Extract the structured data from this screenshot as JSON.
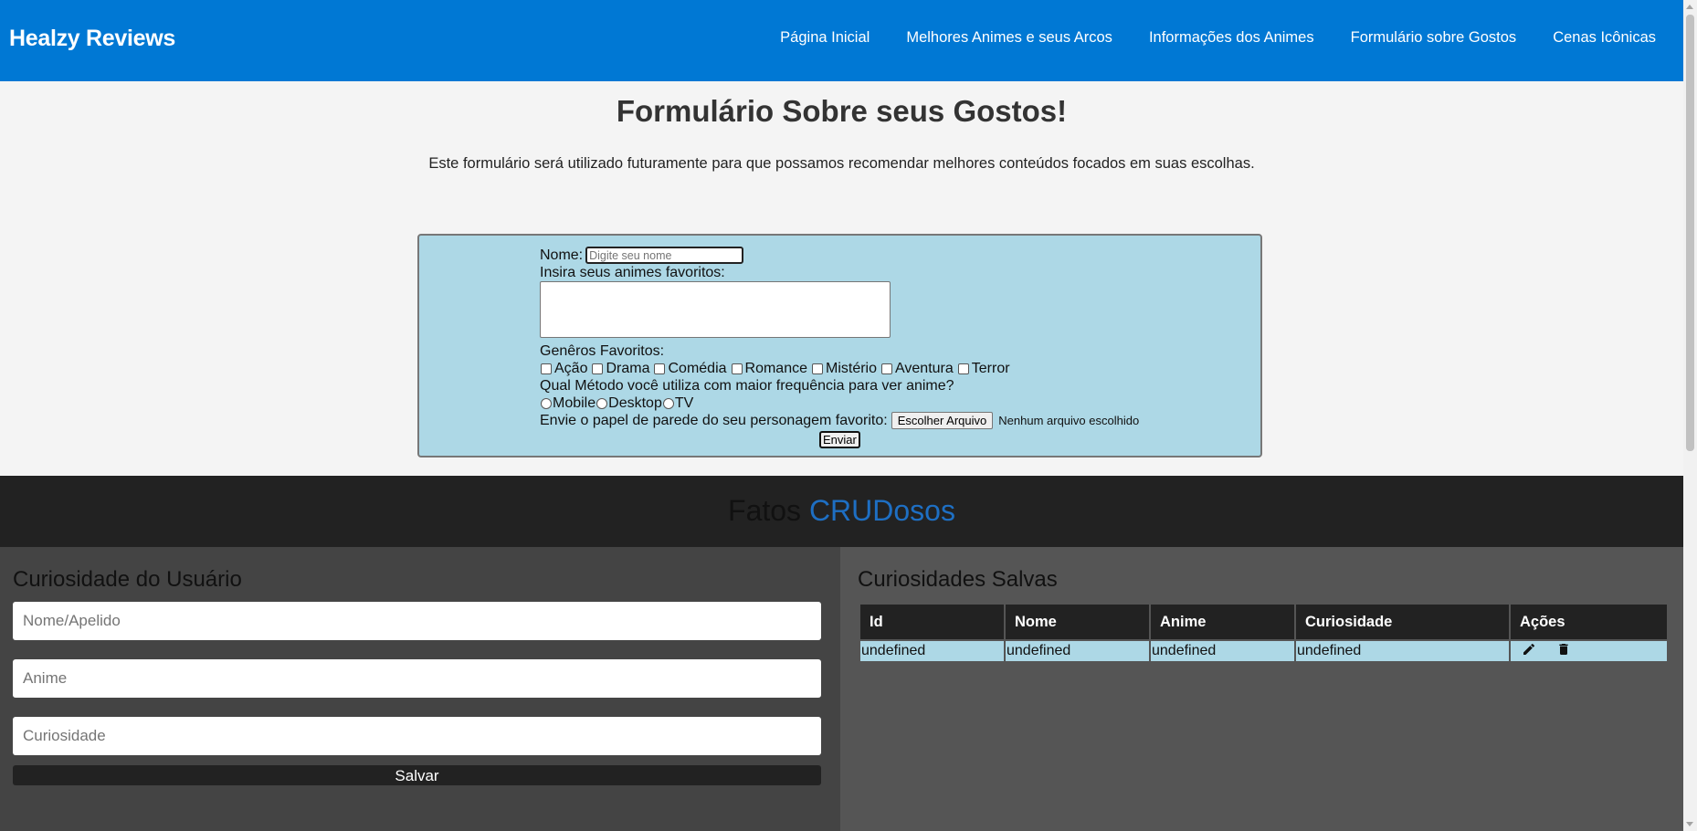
{
  "header": {
    "brand": "Healzy Reviews",
    "nav": [
      "Página Inicial",
      "Melhores Animes e seus Arcos",
      "Informações dos Animes",
      "Formulário sobre Gostos",
      "Cenas Icônicas"
    ]
  },
  "hero": {
    "title": "Formulário Sobre seus Gostos!",
    "subtitle": "Este formulário será utilizado futuramente para que possamos recomendar melhores conteúdos focados em suas escolhas."
  },
  "form": {
    "name_label": "Nome:",
    "name_placeholder": "Digite seu nome",
    "animes_label": "Insira seus animes favoritos:",
    "genres_label": "Genêros Favoritos:",
    "genres": [
      "Ação",
      "Drama",
      "Comédia",
      "Romance",
      "Mistério",
      "Aventura",
      "Terror"
    ],
    "method_label": "Qual Método você utiliza com maior frequência para ver anime?",
    "methods": [
      "Mobile",
      "Desktop",
      "TV"
    ],
    "upload_label": "Envie o papel de parede do seu personagem favorito:",
    "file_button": "Escolher Arquivo",
    "file_status": "Nenhum arquivo escolhido",
    "submit": "Enviar"
  },
  "fatos": {
    "title_plain": "Fatos ",
    "title_highlight": "CRUDosos"
  },
  "user_curiosity": {
    "title": "Curiosidade do Usuário",
    "name_placeholder": "Nome/Apelido",
    "anime_placeholder": "Anime",
    "curiosity_placeholder": "Curiosidade",
    "save": "Salvar"
  },
  "saved": {
    "title": "Curiosidades Salvas",
    "columns": [
      "Id",
      "Nome",
      "Anime",
      "Curiosidade",
      "Ações"
    ],
    "rows": [
      [
        "undefined",
        "undefined",
        "undefined",
        "undefined"
      ]
    ]
  },
  "colors": {
    "header": "#0078d4",
    "form_bg": "#add8e6",
    "highlight": "#1e6fc3",
    "dark": "#222222"
  },
  "icons": [
    "edit-icon",
    "trash-icon"
  ]
}
